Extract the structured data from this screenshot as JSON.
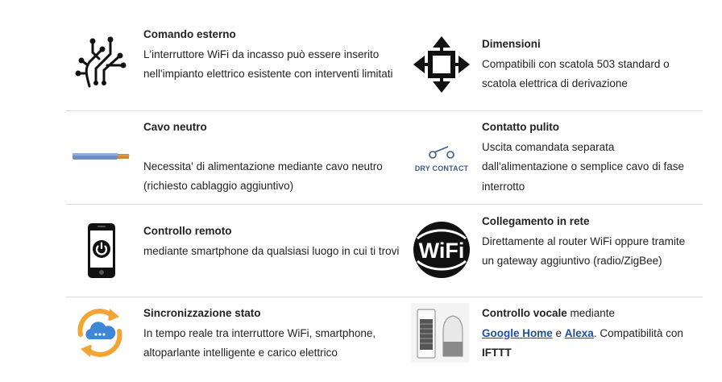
{
  "features": [
    {
      "left": {
        "icon": "circuit-hand-icon",
        "title": "Comando esterno",
        "description": "L'interruttore WiFi da incasso può essere inserito nell'impianto elettrico esistente con interventi limitati"
      },
      "right": {
        "icon": "four-arrows-icon",
        "title": "Dimensioni",
        "description": "Compatibili con scatola 503 standard o scatola elettrica di derivazione"
      }
    },
    {
      "left": {
        "icon": "neutral-cable-icon",
        "title": "Cavo neutro",
        "description": "Necessita' di alimentazione mediante cavo neutro (richiesto cablaggio aggiuntivo)"
      },
      "right": {
        "icon": "dry-contact-icon",
        "icon_label": "DRY CONTACT",
        "title": "Contatto pulito",
        "description": "Uscita comandata separata dall'alimentazione o semplice cavo di fase interrotto"
      }
    },
    {
      "left": {
        "icon": "smartphone-power-icon",
        "title": "Controllo remoto",
        "description": "mediante smartphone da qualsiasi luogo in cui ti trovi"
      },
      "right": {
        "icon": "wifi-logo-icon",
        "icon_label": "WiFi",
        "title": "Collegamento in rete",
        "description": "Direttamente al router WiFi oppure tramite un gateway aggiuntivo (radio/ZigBee)"
      }
    },
    {
      "left": {
        "icon": "cloud-sync-icon",
        "title": "Sincronizzazione stato",
        "description": "In tempo reale tra interruttore WiFi, smartphone, altoparlante intelligente e carico elettrico"
      },
      "right": {
        "icon": "smart-speakers-icon",
        "title": "Controllo vocale",
        "title_suffix": " mediante",
        "link_google": "Google Home",
        "and_text": " e ",
        "link_alexa": "Alexa",
        "compat_text": ". Compatibilità con ",
        "ifttt": "IFTTT"
      }
    }
  ]
}
